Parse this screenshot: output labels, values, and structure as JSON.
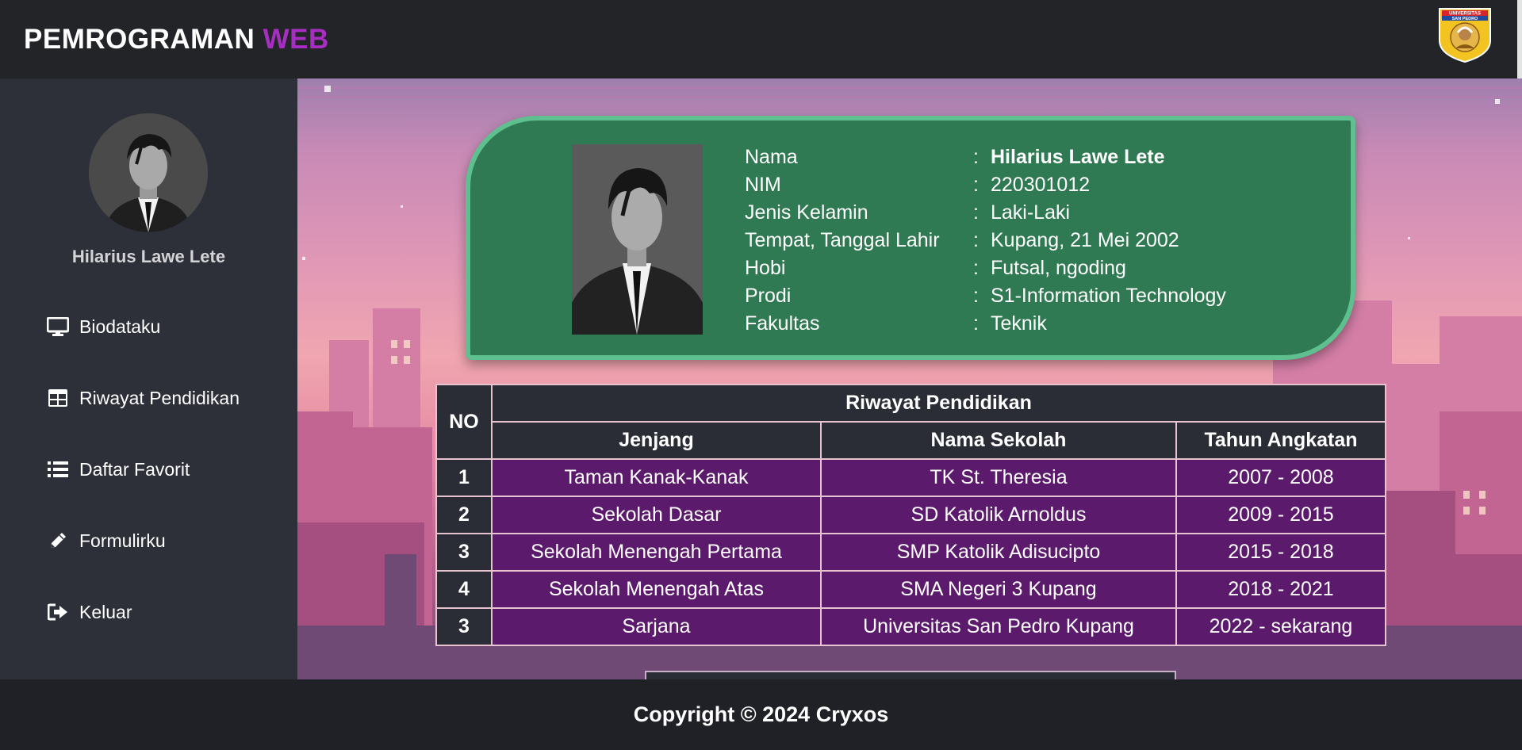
{
  "header": {
    "brand_primary": "PEMROGRAMAN",
    "brand_accent": "WEB",
    "logo_text_top": "UNIVERSITAS",
    "logo_text_bottom": "SAN PEDRO"
  },
  "sidebar": {
    "profile_name": "Hilarius Lawe Lete",
    "items": [
      {
        "label": "Biodataku",
        "icon": "monitor-icon"
      },
      {
        "label": "Riwayat Pendidikan",
        "icon": "table-icon"
      },
      {
        "label": "Daftar Favorit",
        "icon": "list-icon"
      },
      {
        "label": "Formulirku",
        "icon": "pencil-icon"
      },
      {
        "label": "Keluar",
        "icon": "sign-out-icon"
      }
    ]
  },
  "bio": {
    "rows": [
      {
        "label": "Nama",
        "value": "Hilarius Lawe Lete"
      },
      {
        "label": "NIM",
        "value": "220301012"
      },
      {
        "label": "Jenis Kelamin",
        "value": "Laki-Laki"
      },
      {
        "label": "Tempat, Tanggal Lahir",
        "value": "Kupang, 21 Mei 2002"
      },
      {
        "label": "Hobi",
        "value": "Futsal, ngoding"
      },
      {
        "label": "Prodi",
        "value": "S1-Information Technology"
      },
      {
        "label": "Fakultas",
        "value": "Teknik"
      }
    ],
    "separator": ":"
  },
  "education": {
    "title": "Riwayat Pendidikan",
    "col_no": "NO",
    "columns": [
      "Jenjang",
      "Nama Sekolah",
      "Tahun Angkatan"
    ],
    "rows": [
      [
        "1",
        "Taman Kanak-Kanak",
        "TK St. Theresia",
        "2007 - 2008"
      ],
      [
        "2",
        "Sekolah Dasar",
        "SD Katolik Arnoldus",
        "2009 - 2015"
      ],
      [
        "3",
        "Sekolah Menengah Pertama",
        "SMP Katolik Adisucipto",
        "2015 - 2018"
      ],
      [
        "4",
        "Sekolah Menengah Atas",
        "SMA Negeri 3 Kupang",
        "2018 - 2021"
      ],
      [
        "3",
        "Sarjana",
        "Universitas San Pedro Kupang",
        "2022 - sekarang"
      ]
    ]
  },
  "footer": {
    "text": "Copyright © 2024 Cryxos"
  },
  "colors": {
    "brand_accent": "#a62fc2",
    "card_green": "#2f7a52",
    "card_border": "#5fc08f",
    "table_row_purple": "#5b1a6c"
  }
}
